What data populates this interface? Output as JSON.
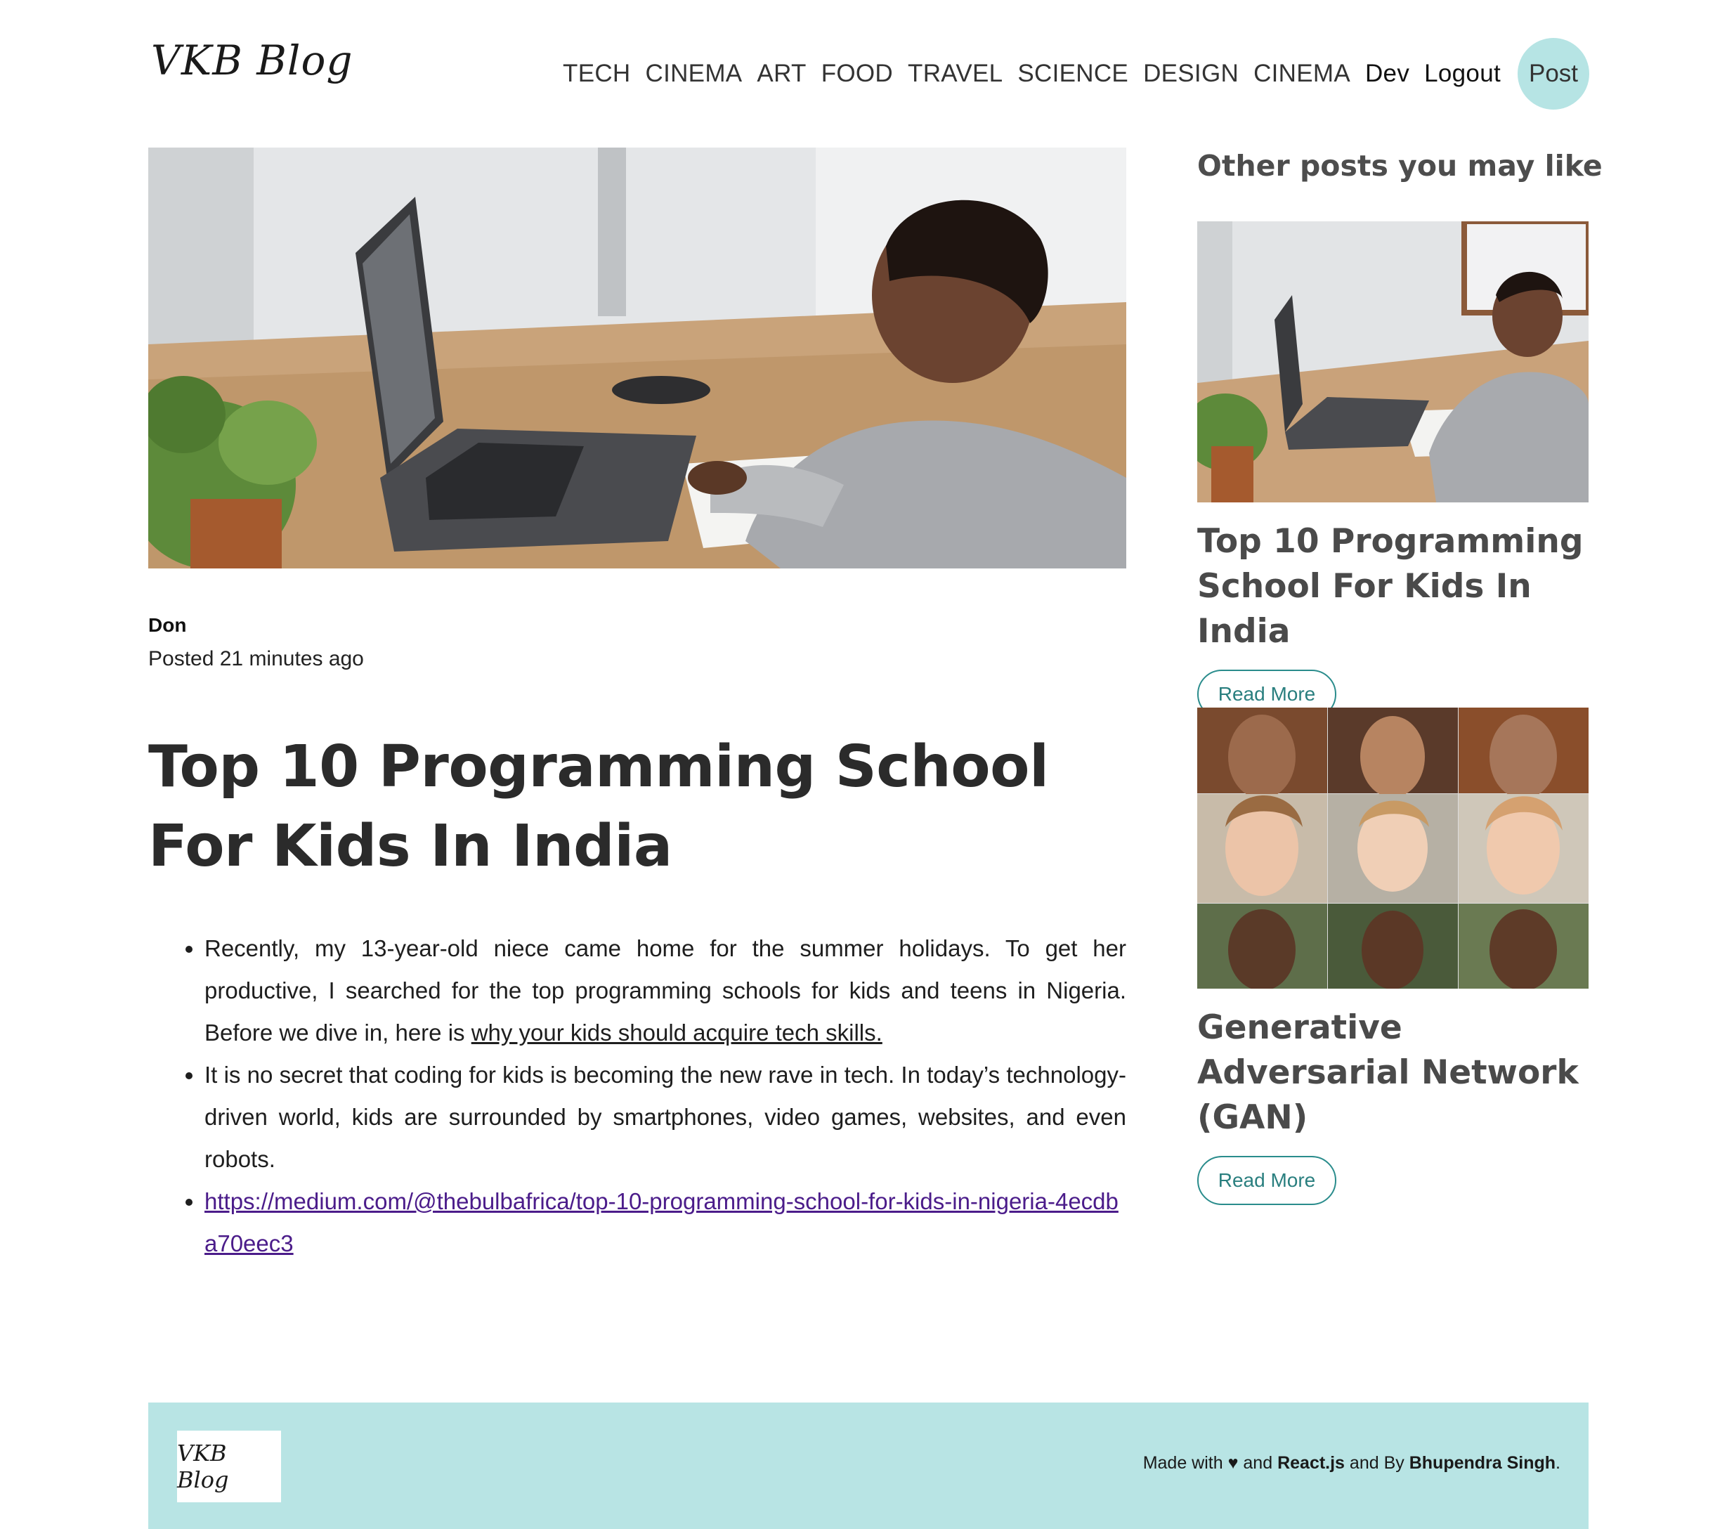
{
  "header": {
    "logo": "VKB Blog",
    "nav": [
      "TECH",
      "CINEMA",
      "ART",
      "FOOD",
      "TRAVEL",
      "SCIENCE",
      "DESIGN",
      "CINEMA"
    ],
    "user": "Dev",
    "logout": "Logout",
    "post": "Post"
  },
  "post": {
    "author": "Don",
    "posted": "Posted 21 minutes ago",
    "title": "Top 10 Programming School For Kids In India",
    "para1_text": "Recently, my 13-year-old niece came home for the summer holidays. To get her productive, I searched for the top programming schools for kids and teens in Nigeria. Before we dive in, here is ",
    "para1_link": "why your kids should acquire tech skills.",
    "para2": "It is no secret that coding for kids is becoming the new rave in tech. In today’s technology-driven world, kids are surrounded by smartphones, video games, websites, and even robots.",
    "link": "https://medium.com/@thebulbafrica/top-10-programming-school-for-kids-in-nigeria-4ecdba70eec3"
  },
  "sidebar": {
    "heading": "Other posts you may like",
    "cards": [
      {
        "title": "Top 10 Programming School For Kids In India",
        "button": "Read More"
      },
      {
        "title": "Generative Adversarial Network (GAN)",
        "button": "Read More"
      }
    ]
  },
  "footer": {
    "logo": "VKB Blog",
    "made_with": "Made with",
    "heart": "♥",
    "and1": "and",
    "tech": "React.js",
    "and_by": "and By",
    "author": "Bhupendra Singh",
    "period": "."
  },
  "colors": {
    "accent": "#b8e4e4",
    "button_border": "#2a8c8c",
    "link_purple": "#4b1c8a"
  }
}
